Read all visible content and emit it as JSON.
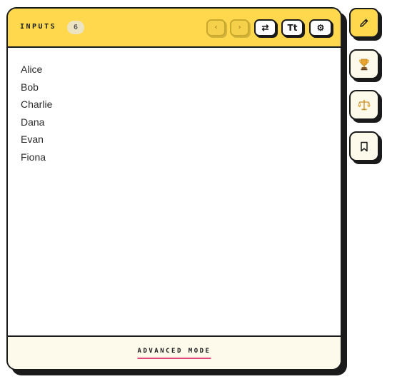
{
  "panel": {
    "title": "INPUTS",
    "count": "6",
    "toolbar": {
      "prev_icon": "chevron-left-icon",
      "prev_glyph": "‹",
      "next_icon": "chevron-right-icon",
      "next_glyph": "›",
      "swap_icon": "swap-arrows-icon",
      "swap_glyph": "⇄",
      "text_icon": "text-size-icon",
      "text_label": "Tt",
      "settings_icon": "gear-icon",
      "settings_glyph": "⚙"
    },
    "items": [
      "Alice",
      "Bob",
      "Charlie",
      "Dana",
      "Evan",
      "Fiona"
    ],
    "footer": {
      "mode_label": "ADVANCED MODE"
    }
  },
  "sidebar": [
    {
      "name": "pencil-icon",
      "active": true
    },
    {
      "name": "trophy-icon",
      "active": false
    },
    {
      "name": "balance-scale-icon",
      "active": false
    },
    {
      "name": "bookmark-icon",
      "active": false
    }
  ],
  "colors": {
    "accent": "#ffd84d",
    "border": "#1a1a1a",
    "footer_bg": "#fdfaeb",
    "underline": "#e0457b",
    "trophy": "#e8a530"
  }
}
